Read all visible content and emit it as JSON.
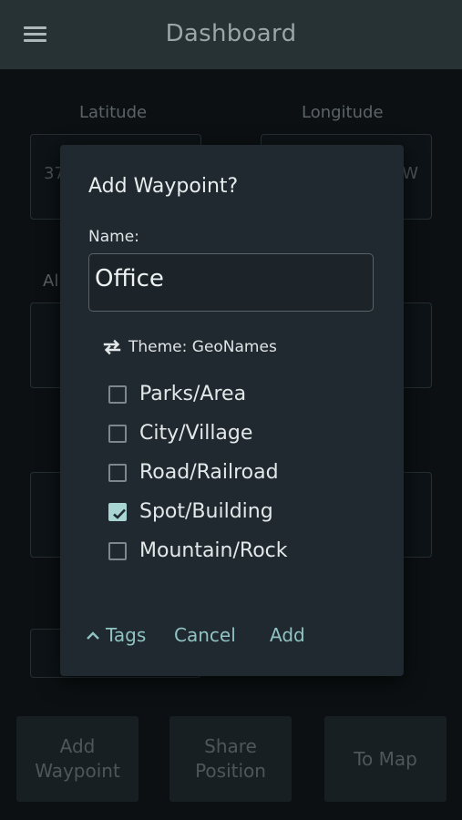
{
  "appbar": {
    "title": "Dashboard",
    "menu_icon": "hamburger-menu-icon"
  },
  "background": {
    "latitude_label": "Latitude",
    "longitude_label": "Longitude",
    "latitude_value_partial": "37",
    "longitude_value_partial": "W",
    "altitude_label_partial": "Al",
    "bottom_buttons": [
      {
        "label": "Add\nWaypoint"
      },
      {
        "label": "Share\nPosition"
      },
      {
        "label": "To Map"
      }
    ]
  },
  "dialog": {
    "title": "Add Waypoint?",
    "name_label": "Name:",
    "name_value": "Office",
    "theme_icon": "swap-icon",
    "theme_label": "Theme: GeoNames",
    "categories": [
      {
        "label": "Parks/Area",
        "checked": false
      },
      {
        "label": "City/Village",
        "checked": false
      },
      {
        "label": "Road/Railroad",
        "checked": false
      },
      {
        "label": "Spot/Building",
        "checked": true
      },
      {
        "label": "Mountain/Rock",
        "checked": false
      }
    ],
    "actions": {
      "tags": "Tags",
      "cancel": "Cancel",
      "add": "Add"
    }
  },
  "colors": {
    "accent": "#8fc4c3",
    "check_fill": "#a9d6d2",
    "dialog_bg": "#202830"
  }
}
